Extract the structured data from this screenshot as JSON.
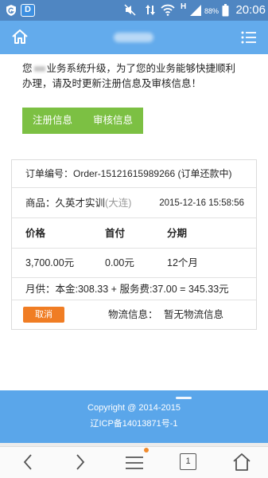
{
  "status_bar": {
    "app_icon_letter": "D",
    "network_type": "H",
    "battery": "88%",
    "time": "20:06",
    "icons": [
      "shield-app-icon",
      "d-app-icon",
      "mute-icon",
      "data-arrows-icon",
      "wifi-icon",
      "signal-bars-icon",
      "battery-icon"
    ],
    "color": "#4f86c2"
  },
  "header": {
    "icons": [
      "home-icon",
      "menu-list-icon"
    ],
    "color": "#63abec"
  },
  "notice": {
    "line1_start": "您",
    "line1_rest": "业务系统升级，为了您的业务能够快捷顺利",
    "line2": "办理，请及时更新注册信息及审核信息！"
  },
  "actions": {
    "register_label": "注册信息",
    "audit_label": "审核信息",
    "color": "#7cc043"
  },
  "order": {
    "number_label": "订单编号：",
    "number": "Order-15121615989266",
    "status": "(订单还款中)",
    "product_label": "商品：",
    "product_name": "久英才实训",
    "product_location": "(大连)",
    "created_at": "2015-12-16 15:58:56",
    "columns": [
      "价格",
      "首付",
      "分期"
    ],
    "values": [
      "3,700.00元",
      "0.00元",
      "12个月"
    ],
    "monthly": "月供：本金:308.33 + 服务费:37.00 = 345.33元",
    "cancel_label": "取消",
    "cancel_color": "#f07d24",
    "logistics_label": "物流信息：",
    "logistics_value": "暂无物流信息"
  },
  "footer": {
    "copyright": "Copyright @ 2014-2015",
    "icp": "辽ICP备14013871号-1",
    "color": "#5aa6ea"
  },
  "browser_nav": {
    "tab_count": "1",
    "icons": [
      "back-icon",
      "forward-icon",
      "menu-icon",
      "tabs-icon",
      "home-icon"
    ],
    "badge_color": "#f08a2c"
  }
}
